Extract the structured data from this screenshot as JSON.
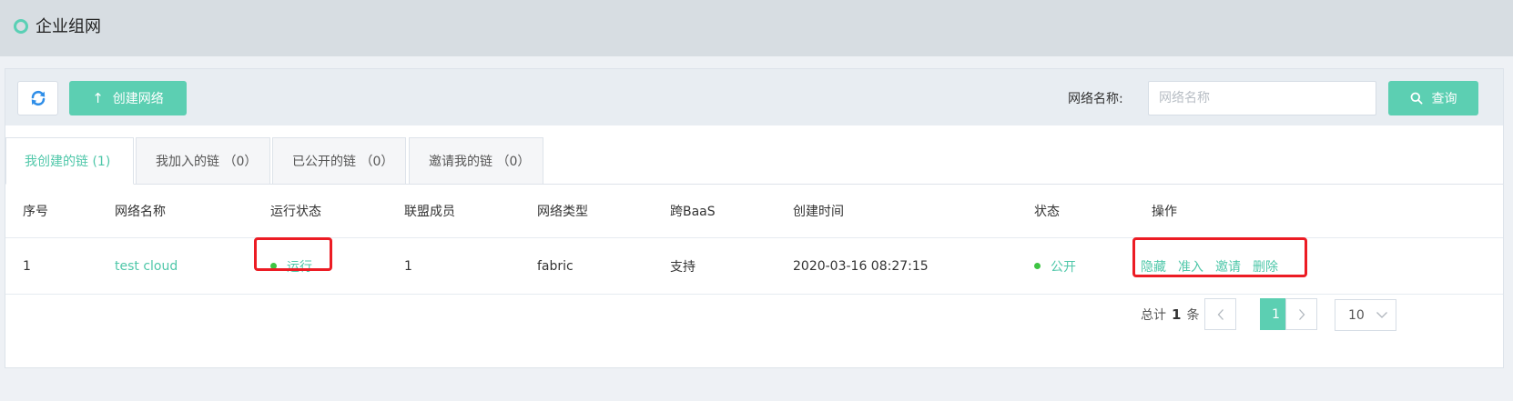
{
  "page": {
    "title": "企业组网"
  },
  "toolbar": {
    "create_label": "创建网络",
    "search_label": "网络名称:",
    "search_placeholder": "网络名称",
    "search_value": "",
    "query_label": "查询"
  },
  "tabs": [
    {
      "label": "我创建的链 (1)",
      "active": true
    },
    {
      "label": "我加入的链 （0）",
      "active": false
    },
    {
      "label": "已公开的链 （0）",
      "active": false
    },
    {
      "label": "邀请我的链 （0）",
      "active": false
    }
  ],
  "table": {
    "columns": [
      "序号",
      "网络名称",
      "运行状态",
      "联盟成员",
      "网络类型",
      "跨BaaS",
      "创建时间",
      "状态",
      "操作"
    ],
    "rows": [
      {
        "index": "1",
        "name": "test cloud",
        "run_status": "运行",
        "members": "1",
        "type": "fabric",
        "cross_baas": "支持",
        "created": "2020-03-16 08:27:15",
        "status": "公开",
        "actions": [
          "隐藏",
          "准入",
          "邀请",
          "删除"
        ]
      }
    ]
  },
  "pagination": {
    "total_prefix": "总计",
    "total_count": "1",
    "total_suffix": "条",
    "current_page": "1",
    "page_size": "10"
  },
  "colors": {
    "accent": "#5ccfb2",
    "link": "#4fc7a9",
    "status_dot": "#3ec443",
    "highlight": "#ec1c24"
  },
  "icons": [
    "refresh-icon",
    "arrow-up-icon",
    "search-icon",
    "chevron-left-icon",
    "chevron-right-icon",
    "chevron-down-icon"
  ]
}
